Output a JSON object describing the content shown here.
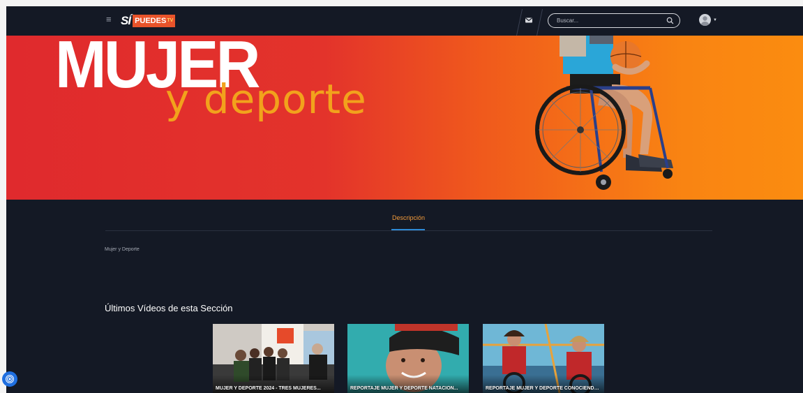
{
  "header": {
    "menu_icon": "hamburger-icon",
    "logo": {
      "si": "SÍ",
      "puedes": "PUEDES",
      "tv": "TV"
    },
    "mail_icon": "envelope-icon",
    "search": {
      "placeholder": "Buscar...",
      "value": "",
      "icon": "search-icon"
    },
    "user_icon": "avatar-icon"
  },
  "banner": {
    "title": "MUJER",
    "subtitle": "y deporte"
  },
  "tabs": [
    {
      "label": "Descripción",
      "active": true
    }
  ],
  "description": "Mujer y Deporte",
  "latest": {
    "title": "Últimos Vídeos de esta Sección",
    "videos": [
      {
        "label": "MUJER Y DEPORTE 2024 - TRES MUJERES..."
      },
      {
        "label": "REPORTAJE MUJER Y DEPORTE NATACIÓN..."
      },
      {
        "label": "REPORTAJE MUJER Y DEPORTE CONOCIENDO..."
      }
    ]
  },
  "colors": {
    "background": "#141925",
    "accent": "#f39b3b",
    "tab_underline": "#2d8ad6",
    "banner_start": "#e02a2d",
    "banner_end": "#fb8c10",
    "fab": "#1f6fe0"
  },
  "floating_button_icon": "accessibility-icon"
}
